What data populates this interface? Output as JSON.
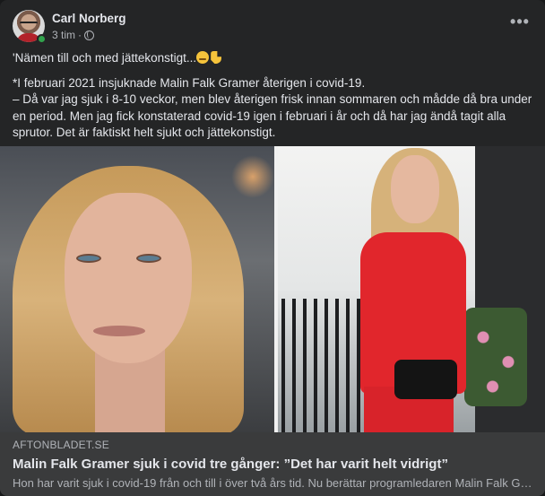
{
  "post": {
    "author": "Carl Norberg",
    "time": "3 tim",
    "separator": "·",
    "privacy_icon": "globe-icon",
    "more_icon": "more-options-icon",
    "more_label": "•••",
    "text_line1": "'Nämen till och med jättekonstigt...",
    "emojis": [
      "rolling-eyes-emoji",
      "pointing-down-emoji"
    ],
    "paragraph1": "*I februari 2021 insjuknade Malin Falk Gramer återigen i covid-19.",
    "paragraph2": "– Då var jag sjuk i 8-10 veckor, men blev återigen frisk innan sommaren och mådde då bra under en period. Men jag fick konstaterad covid-19 igen i februari i år och då har jag ändå tagit alla sprutor. Det är faktiskt helt sjukt och jättekonstigt."
  },
  "link_preview": {
    "domain": "AFTONBLADET.SE",
    "title": "Malin Falk Gramer sjuk i covid tre gånger: ”Det har varit helt vidrigt”",
    "description": "Hon har varit sjuk i covid-19 från och till i över två års tid. Nu berättar programledaren Malin Falk Gramer"
  },
  "colors": {
    "card_bg": "#242526",
    "footer_bg": "#3a3b3c",
    "primary_text": "#e4e6eb",
    "secondary_text": "#b0b3b8",
    "online": "#31a24c"
  }
}
